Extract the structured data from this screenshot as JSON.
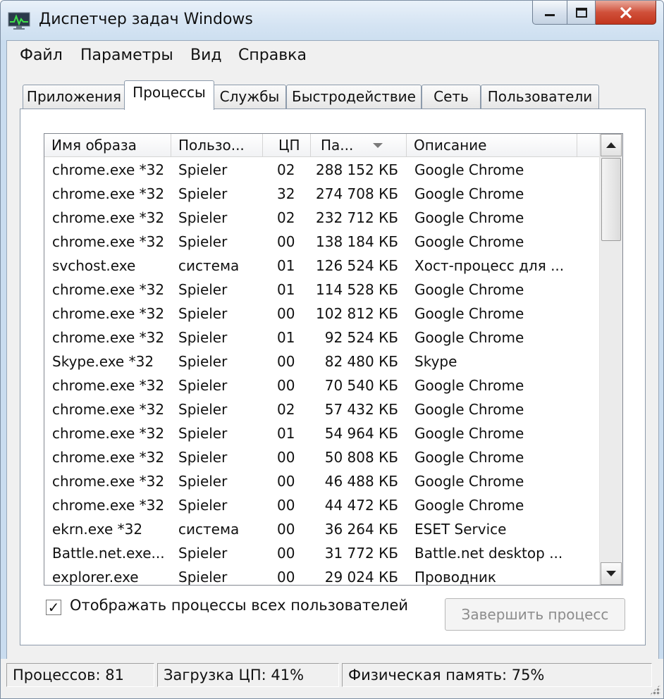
{
  "window": {
    "title": "Диспетчер задач Windows",
    "accent": "#c9dcef",
    "close_color": "#c2351d"
  },
  "icons": {
    "app": "monitor-icon",
    "minimize": "minimize-icon",
    "maximize": "maximize-icon",
    "close": "close-icon",
    "sort": "sort-descending-icon",
    "scroll_up": "scroll-up-icon",
    "scroll_down": "scroll-down-icon",
    "checkbox": "checkmark-icon",
    "grip": "resize-grip-icon"
  },
  "menu": [
    "Файл",
    "Параметры",
    "Вид",
    "Справка"
  ],
  "tabs": [
    "Приложения",
    "Процессы",
    "Службы",
    "Быстродействие",
    "Сеть",
    "Пользователи"
  ],
  "active_tab": "Процессы",
  "columns": [
    "Имя образа",
    "Пользо...",
    "ЦП",
    "Па...",
    "Описание"
  ],
  "processes": [
    {
      "name": "chrome.exe *32",
      "user": "Spieler",
      "cpu": "02",
      "mem": "288 152 КБ",
      "desc": "Google Chrome"
    },
    {
      "name": "chrome.exe *32",
      "user": "Spieler",
      "cpu": "32",
      "mem": "274 708 КБ",
      "desc": "Google Chrome"
    },
    {
      "name": "chrome.exe *32",
      "user": "Spieler",
      "cpu": "02",
      "mem": "232 712 КБ",
      "desc": "Google Chrome"
    },
    {
      "name": "chrome.exe *32",
      "user": "Spieler",
      "cpu": "00",
      "mem": "138 184 КБ",
      "desc": "Google Chrome"
    },
    {
      "name": "svchost.exe",
      "user": "система",
      "cpu": "01",
      "mem": "126 524 КБ",
      "desc": "Хост-процесс для ..."
    },
    {
      "name": "chrome.exe *32",
      "user": "Spieler",
      "cpu": "01",
      "mem": "114 528 КБ",
      "desc": "Google Chrome"
    },
    {
      "name": "chrome.exe *32",
      "user": "Spieler",
      "cpu": "00",
      "mem": "102 812 КБ",
      "desc": "Google Chrome"
    },
    {
      "name": "chrome.exe *32",
      "user": "Spieler",
      "cpu": "01",
      "mem": "92 524 КБ",
      "desc": "Google Chrome"
    },
    {
      "name": "Skype.exe *32",
      "user": "Spieler",
      "cpu": "00",
      "mem": "82 480 КБ",
      "desc": "Skype"
    },
    {
      "name": "chrome.exe *32",
      "user": "Spieler",
      "cpu": "00",
      "mem": "70 540 КБ",
      "desc": "Google Chrome"
    },
    {
      "name": "chrome.exe *32",
      "user": "Spieler",
      "cpu": "02",
      "mem": "57 432 КБ",
      "desc": "Google Chrome"
    },
    {
      "name": "chrome.exe *32",
      "user": "Spieler",
      "cpu": "01",
      "mem": "54 964 КБ",
      "desc": "Google Chrome"
    },
    {
      "name": "chrome.exe *32",
      "user": "Spieler",
      "cpu": "00",
      "mem": "50 808 КБ",
      "desc": "Google Chrome"
    },
    {
      "name": "chrome.exe *32",
      "user": "Spieler",
      "cpu": "00",
      "mem": "46 488 КБ",
      "desc": "Google Chrome"
    },
    {
      "name": "chrome.exe *32",
      "user": "Spieler",
      "cpu": "00",
      "mem": "44 472 КБ",
      "desc": "Google Chrome"
    },
    {
      "name": "ekrn.exe *32",
      "user": "система",
      "cpu": "00",
      "mem": "36 264 КБ",
      "desc": "ESET Service"
    },
    {
      "name": "Battle.net.exe...",
      "user": "Spieler",
      "cpu": "00",
      "mem": "31 772 КБ",
      "desc": "Battle.net desktop ..."
    },
    {
      "name": "explorer.exe",
      "user": "Spieler",
      "cpu": "00",
      "mem": "29 024 КБ",
      "desc": "Проводник"
    }
  ],
  "show_all_users": {
    "label": "Отображать процессы всех пользователей",
    "checked": true,
    "mark": "✓"
  },
  "end_process_label": "Завершить процесс",
  "status": {
    "processes": "Процессов: 81",
    "cpu": "Загрузка ЦП: 41%",
    "memory": "Физическая память: 75%"
  }
}
